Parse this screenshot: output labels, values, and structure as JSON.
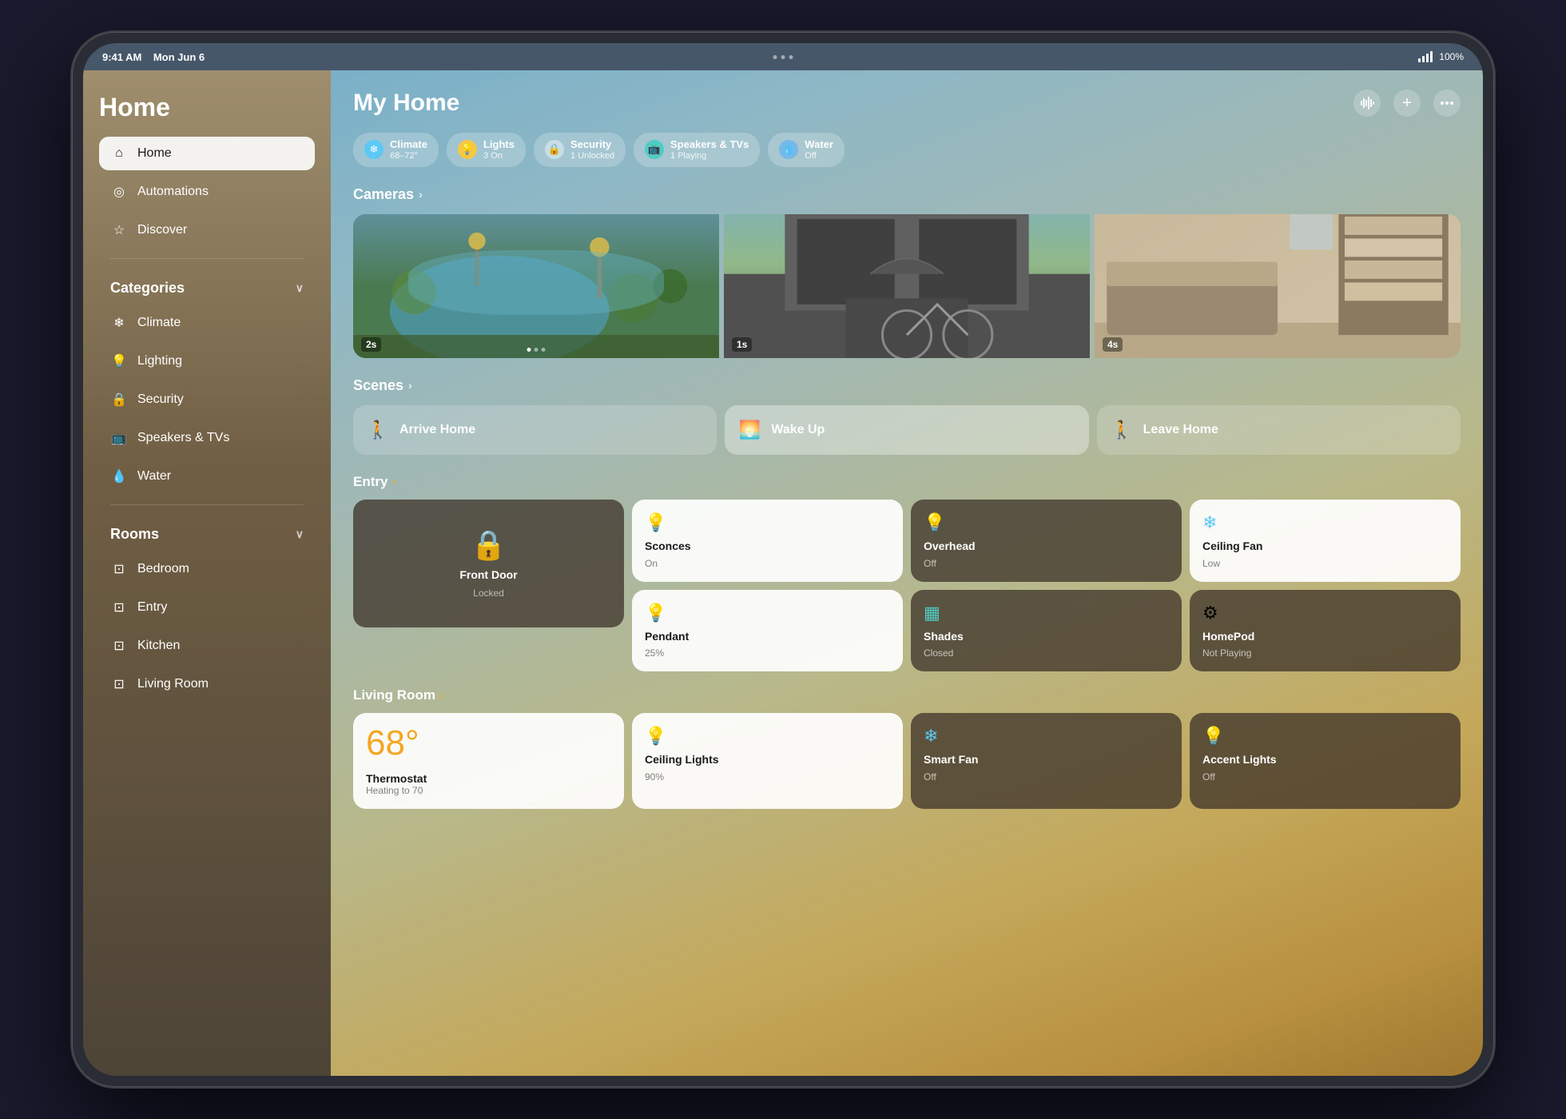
{
  "device": {
    "time": "9:41 AM",
    "date": "Mon Jun 6",
    "battery": "100%",
    "wifi_signal": "full"
  },
  "header_dots": [
    "•",
    "•",
    "•"
  ],
  "header_actions": {
    "waveform": "⠿",
    "add": "+",
    "more": "•••"
  },
  "sidebar": {
    "title": "Home",
    "nav_items": [
      {
        "id": "home",
        "label": "Home",
        "icon": "⌂",
        "active": true
      },
      {
        "id": "automations",
        "label": "Automations",
        "icon": "◎"
      },
      {
        "id": "discover",
        "label": "Discover",
        "icon": "☆"
      }
    ],
    "categories_label": "Categories",
    "categories": [
      {
        "id": "climate",
        "label": "Climate",
        "icon": "❄"
      },
      {
        "id": "lighting",
        "label": "Lighting",
        "icon": "💡"
      },
      {
        "id": "security",
        "label": "Security",
        "icon": "🔒"
      },
      {
        "id": "speakers",
        "label": "Speakers & TVs",
        "icon": "📺"
      },
      {
        "id": "water",
        "label": "Water",
        "icon": "💧"
      }
    ],
    "rooms_label": "Rooms",
    "rooms": [
      {
        "id": "bedroom",
        "label": "Bedroom",
        "icon": "⊡"
      },
      {
        "id": "entry",
        "label": "Entry",
        "icon": "⊡"
      },
      {
        "id": "kitchen",
        "label": "Kitchen",
        "icon": "⊡"
      },
      {
        "id": "living_room",
        "label": "Living Room",
        "icon": "⊡"
      }
    ]
  },
  "main": {
    "title": "My Home",
    "status_chips": [
      {
        "id": "climate",
        "icon_color": "blue",
        "icon": "❄",
        "label": "Climate",
        "sublabel": "68–72°"
      },
      {
        "id": "lights",
        "icon_color": "yellow",
        "icon": "💡",
        "label": "Lights",
        "sublabel": "3 On"
      },
      {
        "id": "security",
        "icon_color": "gray",
        "icon": "🔒",
        "label": "Security",
        "sublabel": "1 Unlocked"
      },
      {
        "id": "speakers",
        "icon_color": "teal",
        "icon": "📺",
        "label": "Speakers & TVs",
        "sublabel": "1 Playing"
      },
      {
        "id": "water",
        "icon_color": "lightblue",
        "icon": "💧",
        "label": "Water",
        "sublabel": "Off"
      }
    ],
    "cameras_section": "Cameras",
    "cameras": [
      {
        "id": "camera1",
        "timestamp": "2s"
      },
      {
        "id": "camera2",
        "timestamp": "1s"
      },
      {
        "id": "camera3",
        "timestamp": "4s"
      }
    ],
    "scenes_section": "Scenes",
    "scenes": [
      {
        "id": "arrive_home",
        "label": "Arrive Home",
        "icon": "🚶",
        "active": false
      },
      {
        "id": "wake_up",
        "label": "Wake Up",
        "icon": "🌅",
        "active": true
      },
      {
        "id": "leave_home",
        "label": "Leave Home",
        "icon": "🚶",
        "active": false
      }
    ],
    "entry_section": "Entry",
    "entry_devices": [
      {
        "id": "front_door",
        "label": "Front Door",
        "status": "Locked",
        "icon": "🔒",
        "type": "door",
        "card_style": "dark"
      },
      {
        "id": "sconces",
        "label": "Sconces",
        "status": "On",
        "icon": "💡",
        "type": "light",
        "card_style": "white"
      },
      {
        "id": "overhead",
        "label": "Overhead",
        "status": "Off",
        "icon": "💡",
        "type": "light",
        "card_style": "dark"
      },
      {
        "id": "ceiling_fan",
        "label": "Ceiling Fan",
        "status": "Low",
        "icon": "❄",
        "type": "fan",
        "card_style": "white"
      },
      {
        "id": "pendant",
        "label": "Pendant",
        "status": "25%",
        "icon": "💡",
        "type": "light",
        "card_style": "white"
      },
      {
        "id": "shades",
        "label": "Shades",
        "status": "Closed",
        "icon": "▦",
        "type": "shade",
        "card_style": "dark"
      },
      {
        "id": "homepod",
        "label": "HomePod",
        "status": "Not Playing",
        "icon": "⚙",
        "type": "speaker",
        "card_style": "dark"
      }
    ],
    "living_room_section": "Living Room",
    "living_room_devices": [
      {
        "id": "thermostat",
        "label": "Thermostat",
        "status": "Heating to 70",
        "temp": "68°",
        "type": "thermostat",
        "card_style": "white"
      },
      {
        "id": "ceiling_lights",
        "label": "Ceiling Lights",
        "status": "90%",
        "icon": "💡",
        "type": "light",
        "card_style": "white"
      },
      {
        "id": "smart_fan",
        "label": "Smart Fan",
        "status": "Off",
        "icon": "❄",
        "type": "fan",
        "card_style": "dark"
      },
      {
        "id": "accent_lights",
        "label": "Accent Lights",
        "status": "Off",
        "icon": "💡",
        "type": "light",
        "card_style": "dark"
      }
    ]
  }
}
